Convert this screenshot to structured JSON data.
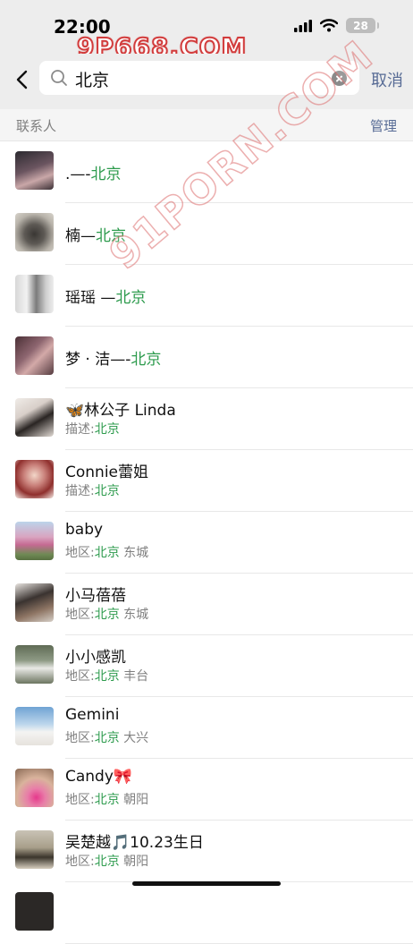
{
  "status": {
    "time": "22:00",
    "battery": "28"
  },
  "watermarks": {
    "top": "9P668.COM",
    "diagonal": "91PORN.COM"
  },
  "search": {
    "value": "北京",
    "cancel_label": "取消"
  },
  "section": {
    "title": "联系人",
    "manage_label": "管理"
  },
  "contacts": [
    {
      "prefix": ".—-",
      "match": "北京",
      "suffix": "",
      "sub_label": "",
      "sub_match": "",
      "sub_suffix": ""
    },
    {
      "prefix": "楠—",
      "match": "北京",
      "suffix": "",
      "sub_label": "",
      "sub_match": "",
      "sub_suffix": ""
    },
    {
      "prefix": "瑶瑶 —",
      "match": "北京",
      "suffix": "",
      "sub_label": "",
      "sub_match": "",
      "sub_suffix": ""
    },
    {
      "prefix": "梦 · 洁—-",
      "match": "北京",
      "suffix": "",
      "sub_label": "",
      "sub_match": "",
      "sub_suffix": ""
    },
    {
      "prefix": "🦋林公子 Linda",
      "match": "",
      "suffix": "",
      "sub_label": "描述:",
      "sub_match": "北京",
      "sub_suffix": ""
    },
    {
      "prefix": "Connie蕾姐",
      "match": "",
      "suffix": "",
      "sub_label": "描述:",
      "sub_match": "北京",
      "sub_suffix": ""
    },
    {
      "prefix": "baby",
      "match": "",
      "suffix": "",
      "sub_label": "地区:",
      "sub_match": "北京",
      "sub_suffix": " 东城"
    },
    {
      "prefix": "小马蓓蓓",
      "match": "",
      "suffix": "",
      "sub_label": "地区:",
      "sub_match": "北京",
      "sub_suffix": " 东城"
    },
    {
      "prefix": "小小感凯",
      "match": "",
      "suffix": "",
      "sub_label": "地区:",
      "sub_match": "北京",
      "sub_suffix": " 丰台"
    },
    {
      "prefix": "Gemini",
      "match": "",
      "suffix": "",
      "sub_label": "地区:",
      "sub_match": "北京",
      "sub_suffix": " 大兴"
    },
    {
      "prefix": "Candy🎀",
      "match": "",
      "suffix": "",
      "sub_label": "地区:",
      "sub_match": "北京",
      "sub_suffix": " 朝阳"
    },
    {
      "prefix": "吴楚越🎵10.23生日",
      "match": "",
      "suffix": "",
      "sub_label": "地区:",
      "sub_match": "北京",
      "sub_suffix": " 朝阳"
    }
  ],
  "colors": {
    "highlight": "#2d9b4d",
    "link": "#576b95",
    "bar_bg": "#ededed"
  }
}
